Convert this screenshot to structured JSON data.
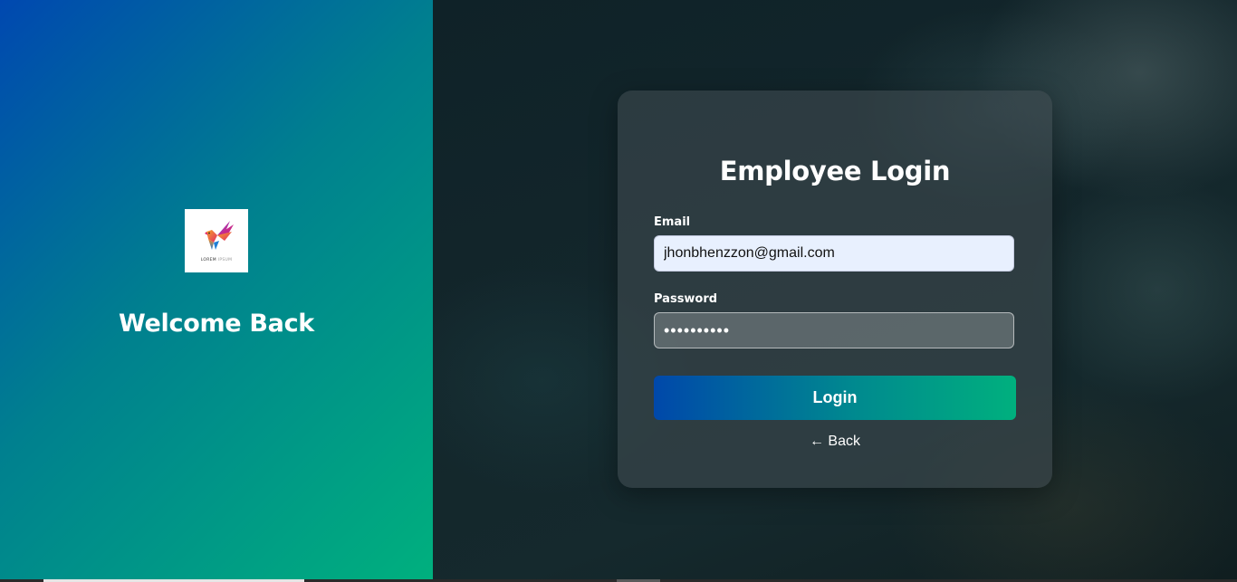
{
  "left_panel": {
    "logo": {
      "icon": "bird-logo-icon",
      "text_bold": "LOREM",
      "text_light": "IPSUM"
    },
    "welcome_text": "Welcome Back"
  },
  "login_card": {
    "title": "Employee Login",
    "email": {
      "label": "Email",
      "value": "jhonbhenzzon@gmail.com"
    },
    "password": {
      "label": "Password",
      "value": "••••••••••"
    },
    "login_button": "Login",
    "back_link": "← Back"
  },
  "colors": {
    "brand_gradient_start": "#0048b0",
    "brand_gradient_end": "#00b07e"
  }
}
